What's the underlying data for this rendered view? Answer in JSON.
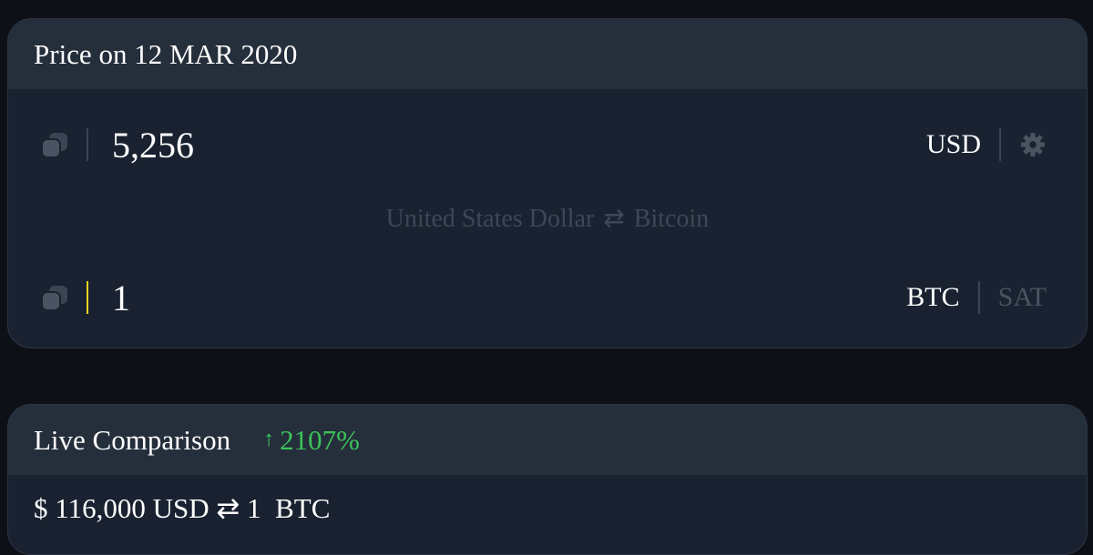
{
  "historical": {
    "title": "Price on 12 MAR 2020",
    "fiat_amount": "5,256",
    "fiat_unit": "USD",
    "pair_from": "United States Dollar",
    "pair_swap_icon": "swap-arrows-icon",
    "pair_to": "Bitcoin",
    "btc_amount": "1",
    "btc_unit": "BTC",
    "alt_unit": "SAT",
    "settings_icon": "gear-icon",
    "copy_icon": "copy-icon"
  },
  "live": {
    "title": "Live Comparison",
    "change_icon": "arrow-up-icon",
    "change": "2107%",
    "fiat_value": "$ 116,000 USD",
    "swap_icon": "swap-arrows-icon",
    "btc_value": "1  BTC"
  },
  "colors": {
    "background": "#0d1117",
    "card": "#1a2231",
    "card_header": "#252e3b",
    "positive": "#3cc45a",
    "active_cursor": "#e8d51e",
    "muted_text": "#3d4756"
  }
}
